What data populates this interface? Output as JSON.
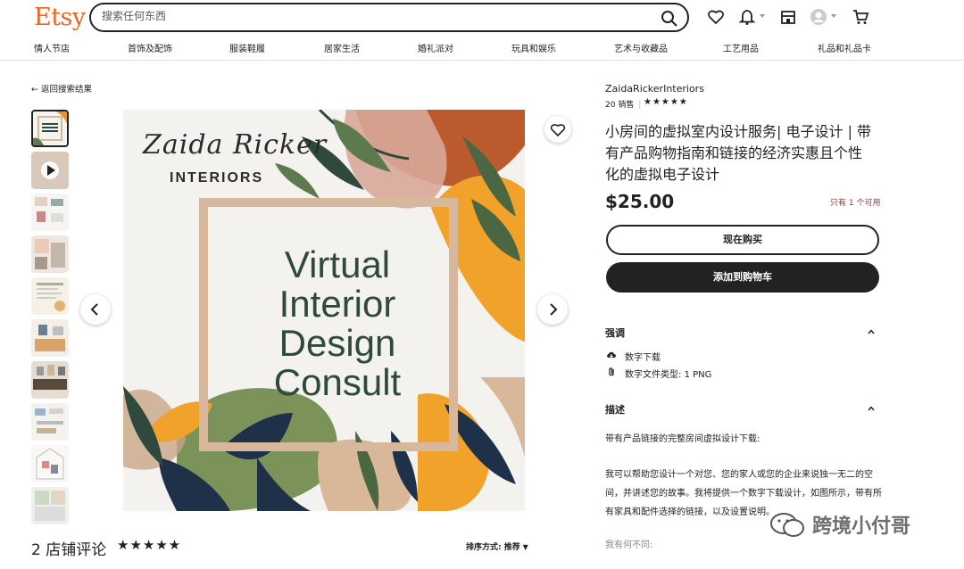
{
  "header": {
    "logo": "Etsy",
    "search_placeholder": "搜索任何东西"
  },
  "categories": [
    "情人节店",
    "首饰及配饰",
    "服装鞋履",
    "居家生活",
    "婚礼派对",
    "玩具和娱乐",
    "艺术与收藏品",
    "工艺用品",
    "礼品和礼品卡"
  ],
  "back_link": "返回搜索结果",
  "gallery": {
    "main_text": [
      "Virtual",
      "Interior",
      "Design",
      "Consult"
    ],
    "brand_script": "Zaida Ricker",
    "brand_sub": "INTERIORS",
    "thumb_text": "Virtual Interior Design Consult"
  },
  "reviews": {
    "title": "2 店铺评论",
    "stars": "★★★★★",
    "sort_label": "排序方式: 推荐"
  },
  "listing": {
    "shop_name": "ZaidaRickerInteriors",
    "sales": "20 销售",
    "stars": "★★★★★",
    "title": "小房间的虚拟室内设计服务| 电子设计 | 带有产品购物指南和链接的经济实惠且个性化的虚拟电子设计",
    "price": "$25.00",
    "stock": "只有 1 个可用",
    "buy_now": "现在购买",
    "add_to_cart": "添加到购物车"
  },
  "highlights": {
    "heading": "强调",
    "items": [
      "数字下载",
      "数字文件类型: 1 PNG"
    ]
  },
  "description": {
    "heading": "描述",
    "line1": "带有产品链接的完整房间虚拟设计下载:",
    "para": "我可以帮助您设计一个对您、您的家人或您的企业来说独一无二的空间，并讲述您的故事。我将提供一个数字下载设计，如图所示，带有所有家具和配件选择的链接，以及设置说明。",
    "line3": "我有何不同:"
  },
  "watermark": "跨境小付哥",
  "colors": {
    "accent": "#f1641e",
    "dark": "#222222",
    "stock": "#b4282d"
  }
}
